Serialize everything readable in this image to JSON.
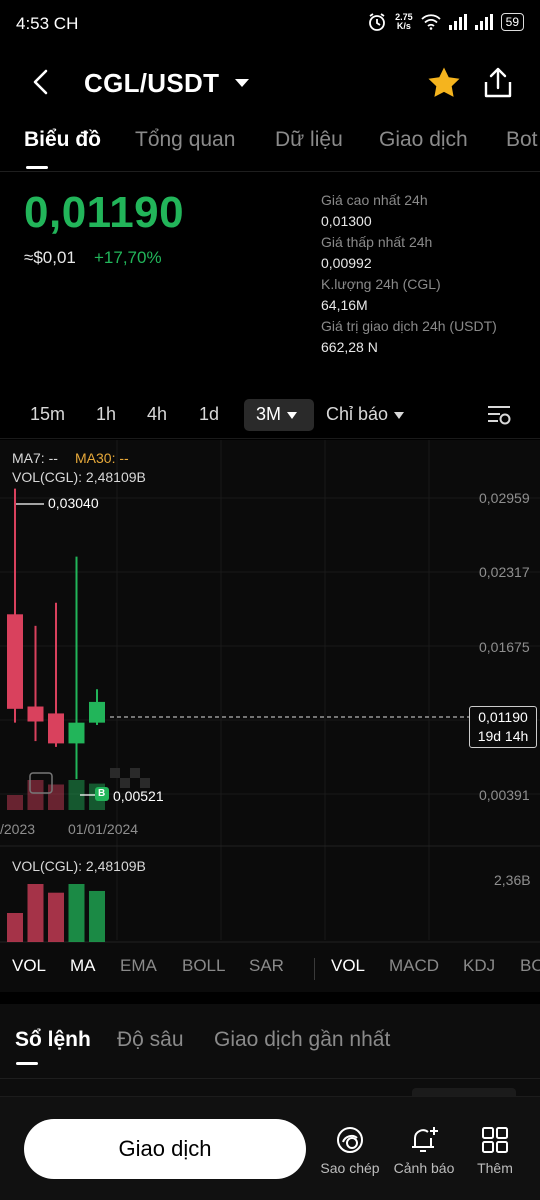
{
  "status_bar": {
    "time": "4:53 CH",
    "net_speed_value": "2.75",
    "net_speed_unit": "K/s",
    "battery": "59"
  },
  "header": {
    "pair": "CGL/USDT",
    "star_color": "#f5b41e"
  },
  "tabs": [
    {
      "label": "Biểu đồ",
      "active": true
    },
    {
      "label": "Tổng quan"
    },
    {
      "label": "Dữ liệu"
    },
    {
      "label": "Giao dịch"
    },
    {
      "label": "Bot"
    }
  ],
  "ticker": {
    "last_price": "0,01190",
    "usd_price": "≈$0,01",
    "change_pct": "+17,70%",
    "up_color": "#22b55a",
    "down_color": "#d9415d",
    "stats": [
      {
        "label": "Giá cao nhất 24h",
        "value": "0,01300"
      },
      {
        "label": "Giá thấp nhất 24h",
        "value": "0,00992"
      },
      {
        "label": "K.lượng 24h (CGL)",
        "value": "64,16M"
      },
      {
        "label": "Giá trị giao dịch 24h (USDT)",
        "value": "662,28 N"
      }
    ]
  },
  "timeframes": {
    "items": [
      "15m",
      "1h",
      "4h",
      "1d"
    ],
    "selected": "3M",
    "indicator_menu": "Chỉ báo"
  },
  "chart": {
    "ma7_label": "MA7: --",
    "ma30_label": "MA30: --",
    "vol_label": "VOL(CGL): 2,48109B",
    "high_marker": "0,03040",
    "low_marker": "0,00521",
    "buy_marker": "B",
    "price_axis": [
      "0,02959",
      "0,02317",
      "0,01675",
      "0,01190",
      "0,00391"
    ],
    "last_price_tag": "0,01190",
    "countdown": "19d 14h",
    "date_left": "/2023",
    "date_right": "01/01/2024",
    "vol_pane_label": "VOL(CGL): 2,48109B",
    "vol_axis": "2,36B"
  },
  "chart_data": {
    "type": "candlestick",
    "interval": "3M",
    "ohlc": [
      {
        "open": 0.0195,
        "high": 0.0304,
        "low": 0.0101,
        "close": 0.0113,
        "dir": "down"
      },
      {
        "open": 0.0115,
        "high": 0.0185,
        "low": 0.0085,
        "close": 0.0102,
        "dir": "down"
      },
      {
        "open": 0.0109,
        "high": 0.0205,
        "low": 0.008,
        "close": 0.0083,
        "dir": "down"
      },
      {
        "open": 0.0083,
        "high": 0.0245,
        "low": 0.0052,
        "close": 0.0101,
        "dir": "up"
      },
      {
        "open": 0.0101,
        "high": 0.013,
        "low": 0.0099,
        "close": 0.0119,
        "dir": "up"
      }
    ],
    "volume_relative": [
      0.5,
      1.0,
      0.85,
      1.0,
      0.88
    ]
  },
  "indicators": {
    "main": [
      "VOL",
      "MA",
      "EMA",
      "BOLL",
      "SAR"
    ],
    "sub": [
      "VOL",
      "MACD",
      "KDJ",
      "BOLL"
    ]
  },
  "order_book": {
    "tabs": [
      "Sổ lệnh",
      "Độ sâu",
      "Giao dịch gần nhất"
    ]
  },
  "bottom_bar": {
    "trade_label": "Giao dịch",
    "copy_label": "Sao chép",
    "alert_label": "Cảnh báo",
    "more_label": "Thêm"
  }
}
